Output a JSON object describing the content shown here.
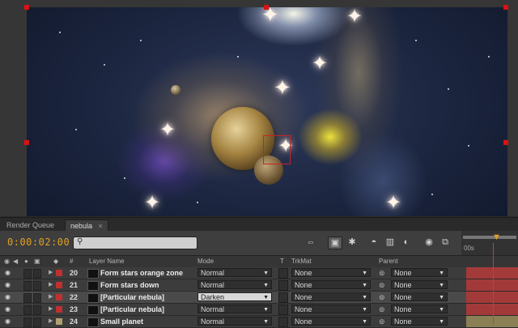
{
  "tabs": [
    {
      "label": "Render Queue",
      "active": false
    },
    {
      "label": "nebula",
      "active": true,
      "close": "×"
    }
  ],
  "timecode": "0:00:02:00",
  "search": {
    "placeholder": "",
    "icon": "search-icon"
  },
  "ruler": {
    "start_label": "00s"
  },
  "headers": {
    "layer_name": "Layer Name",
    "mode": "Mode",
    "t": "T",
    "trkmat": "TrkMat",
    "parent": "Parent",
    "number": "#"
  },
  "layers": [
    {
      "num": "20",
      "name": "Form stars orange zone",
      "mode": "Normal",
      "trkmat": "None",
      "parent": "None",
      "label_color": "#c03030",
      "bar_color": "#a33a3a",
      "selected": false
    },
    {
      "num": "21",
      "name": "Form stars down",
      "mode": "Normal",
      "trkmat": "None",
      "parent": "None",
      "label_color": "#c03030",
      "bar_color": "#a33a3a",
      "selected": false
    },
    {
      "num": "22",
      "name": "[Particular nebula]",
      "mode": "Darken",
      "trkmat": "None",
      "parent": "None",
      "label_color": "#c03030",
      "bar_color": "#a33a3a",
      "selected": true
    },
    {
      "num": "23",
      "name": "[Particular nebula]",
      "mode": "Normal",
      "trkmat": "None",
      "parent": "None",
      "label_color": "#c03030",
      "bar_color": "#a33a3a",
      "selected": false
    },
    {
      "num": "24",
      "name": "Small planet",
      "mode": "Normal",
      "trkmat": "None",
      "parent": "None",
      "label_color": "#b0a070",
      "bar_color": "#8a7f55",
      "selected": false
    }
  ],
  "colors": {
    "accent_timecode": "#e0a020",
    "selection_red": "#d11111"
  }
}
